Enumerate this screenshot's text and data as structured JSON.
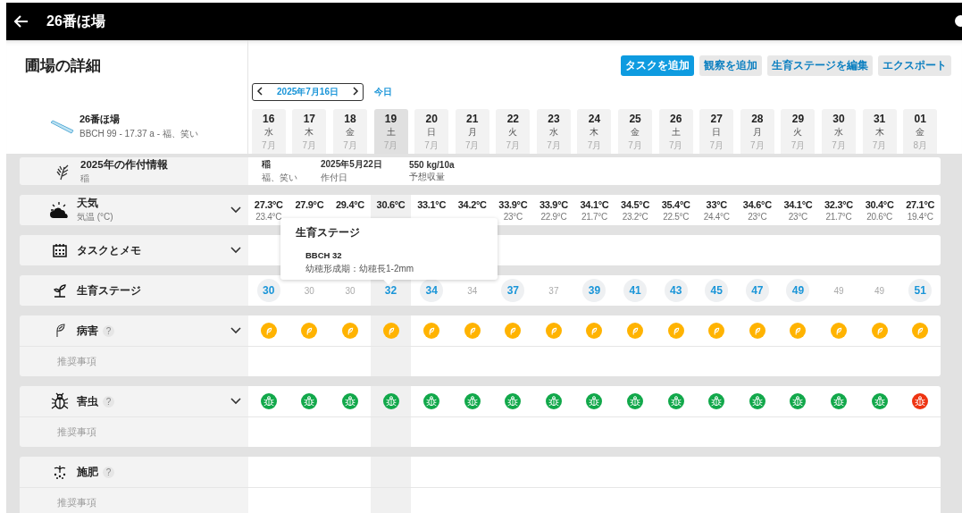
{
  "app_bar": {
    "title": "26番ほ場"
  },
  "page_title": "圃場の詳細",
  "buttons": [
    {
      "label": "タスクを追加",
      "primary": true
    },
    {
      "label": "観察を追加",
      "primary": false
    },
    {
      "label": "生育ステージを編集",
      "primary": false
    },
    {
      "label": "エクスポート",
      "primary": false
    }
  ],
  "date_nav": {
    "date": "2025年7月16日",
    "today": "今日"
  },
  "field": {
    "name": "26番ほ場",
    "meta": "BBCH 99 - 17.37 a - 福、笑い"
  },
  "dates": [
    {
      "day": "16",
      "weekday": "水",
      "month": "7月",
      "selected": false
    },
    {
      "day": "17",
      "weekday": "木",
      "month": "7月",
      "selected": false
    },
    {
      "day": "18",
      "weekday": "金",
      "month": "7月",
      "selected": false
    },
    {
      "day": "19",
      "weekday": "土",
      "month": "7月",
      "selected": true
    },
    {
      "day": "20",
      "weekday": "日",
      "month": "7月",
      "selected": false
    },
    {
      "day": "21",
      "weekday": "月",
      "month": "7月",
      "selected": false
    },
    {
      "day": "22",
      "weekday": "火",
      "month": "7月",
      "selected": false
    },
    {
      "day": "23",
      "weekday": "水",
      "month": "7月",
      "selected": false
    },
    {
      "day": "24",
      "weekday": "木",
      "month": "7月",
      "selected": false
    },
    {
      "day": "25",
      "weekday": "金",
      "month": "7月",
      "selected": false
    },
    {
      "day": "26",
      "weekday": "土",
      "month": "7月",
      "selected": false
    },
    {
      "day": "27",
      "weekday": "日",
      "month": "7月",
      "selected": false
    },
    {
      "day": "28",
      "weekday": "月",
      "month": "7月",
      "selected": false
    },
    {
      "day": "29",
      "weekday": "火",
      "month": "7月",
      "selected": false
    },
    {
      "day": "30",
      "weekday": "水",
      "month": "7月",
      "selected": false
    },
    {
      "day": "31",
      "weekday": "木",
      "month": "7月",
      "selected": false
    },
    {
      "day": "01",
      "weekday": "金",
      "month": "8月",
      "selected": false
    }
  ],
  "crop_info": {
    "title": "2025年の作付情報",
    "subtitle": "稲",
    "items": [
      {
        "value": "稲",
        "label": "福、笑い"
      },
      {
        "value": "2025年5月22日",
        "label": "作付日"
      },
      {
        "value": "550 kg/10a",
        "label": "予想収量"
      }
    ]
  },
  "rows": [
    {
      "kind": "weather",
      "title": "天気",
      "subtitle": "気温 (°C)",
      "expandable": true,
      "days": [
        {
          "high": "27.3°C",
          "low": "23.4°C"
        },
        {
          "high": "27.9°C"
        },
        {
          "high": "29.4°C"
        },
        {
          "high": "30.6°C"
        },
        {
          "high": "33.1°C"
        },
        {
          "high": "34.2°C"
        },
        {
          "high": "33.9°C",
          "low": "23°C"
        },
        {
          "high": "33.9°C",
          "low": "22.9°C"
        },
        {
          "high": "34.1°C",
          "low": "21.7°C"
        },
        {
          "high": "34.5°C",
          "low": "23.2°C"
        },
        {
          "high": "35.4°C",
          "low": "22.5°C"
        },
        {
          "high": "33°C",
          "low": "24.4°C"
        },
        {
          "high": "34.6°C",
          "low": "23°C"
        },
        {
          "high": "34.1°C",
          "low": "23°C"
        },
        {
          "high": "32.3°C",
          "low": "21.7°C"
        },
        {
          "high": "30.4°C",
          "low": "20.6°C"
        },
        {
          "high": "27.1°C",
          "low": "19.4°C"
        }
      ]
    },
    {
      "kind": "tasks",
      "title": "タスクとメモ",
      "expandable": true
    },
    {
      "kind": "stage",
      "title": "生育ステージ",
      "expandable": false,
      "values": [
        {
          "value": "30",
          "changed": true
        },
        {
          "value": "30",
          "changed": false
        },
        {
          "value": "30",
          "changed": false
        },
        {
          "value": "32",
          "changed": true
        },
        {
          "value": "34",
          "changed": true
        },
        {
          "value": "34",
          "changed": false
        },
        {
          "value": "37",
          "changed": true
        },
        {
          "value": "37",
          "changed": false
        },
        {
          "value": "39",
          "changed": true
        },
        {
          "value": "41",
          "changed": true
        },
        {
          "value": "43",
          "changed": true
        },
        {
          "value": "45",
          "changed": true
        },
        {
          "value": "47",
          "changed": true
        },
        {
          "value": "49",
          "changed": true
        },
        {
          "value": "49",
          "changed": false
        },
        {
          "value": "49",
          "changed": false
        },
        {
          "value": "51",
          "changed": true
        }
      ]
    },
    {
      "kind": "disease",
      "title": "病害",
      "help": "?",
      "expandable": true,
      "recommendation": "推奨事項",
      "badges": [
        {
          "color": "#ffb300"
        },
        {
          "color": "#ffb300"
        },
        {
          "color": "#ffb300"
        },
        {
          "color": "#ffb300"
        },
        {
          "color": "#ffb300"
        },
        {
          "color": "#ffb300"
        },
        {
          "color": "#ffb300"
        },
        {
          "color": "#ffb300"
        },
        {
          "color": "#ffb300"
        },
        {
          "color": "#ffb300"
        },
        {
          "color": "#ffb300"
        },
        {
          "color": "#ffb300"
        },
        {
          "color": "#ffb300"
        },
        {
          "color": "#ffb300"
        },
        {
          "color": "#ffb300"
        },
        {
          "color": "#ffb300"
        },
        {
          "color": "#ffb300"
        }
      ]
    },
    {
      "kind": "pest",
      "title": "害虫",
      "help": "?",
      "expandable": true,
      "recommendation": "推奨事項",
      "badges": [
        {
          "color": "#11a84a"
        },
        {
          "color": "#11a84a"
        },
        {
          "color": "#11a84a"
        },
        {
          "color": "#11a84a"
        },
        {
          "color": "#11a84a"
        },
        {
          "color": "#11a84a"
        },
        {
          "color": "#11a84a"
        },
        {
          "color": "#11a84a"
        },
        {
          "color": "#11a84a"
        },
        {
          "color": "#11a84a"
        },
        {
          "color": "#11a84a"
        },
        {
          "color": "#11a84a"
        },
        {
          "color": "#11a84a"
        },
        {
          "color": "#11a84a"
        },
        {
          "color": "#11a84a"
        },
        {
          "color": "#11a84a"
        },
        {
          "color": "#ee3311"
        }
      ]
    },
    {
      "kind": "fertilizer",
      "title": "施肥",
      "help": "?",
      "expandable": false,
      "recommendation": "推奨事項"
    }
  ],
  "tooltip": {
    "title": "生育ステージ",
    "code": "BBCH 32",
    "description": "幼穂形成期：幼穂長1-2mm"
  }
}
